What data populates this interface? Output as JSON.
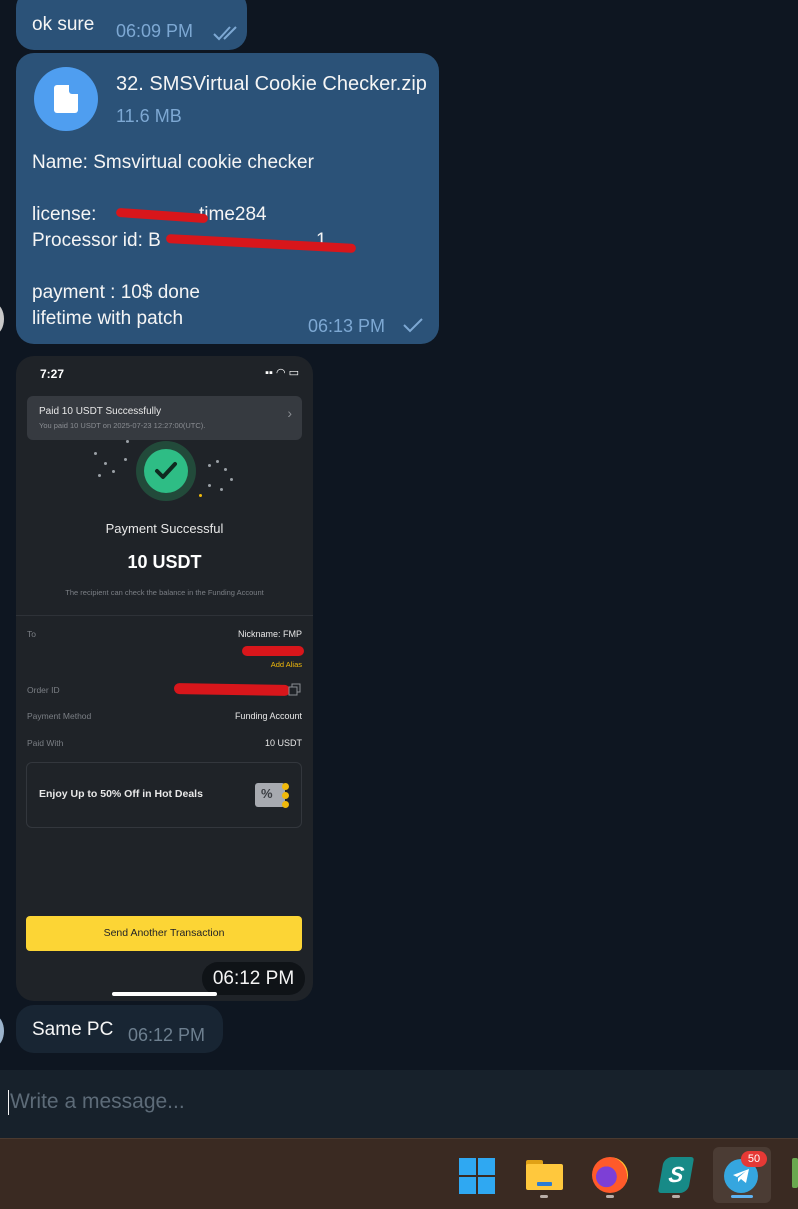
{
  "messages": {
    "ok_sure": {
      "text": "ok sure",
      "time": "06:09 PM"
    },
    "file_msg": {
      "file_name": "32. SMSVirtual Cookie Checker.zip",
      "file_size": "11.6 MB",
      "line_name": "Name: Smsvirtual cookie checker",
      "line_license": "license: ",
      "line_license_visible": "time284",
      "line_processor": "Processor id: B",
      "line_processor_tail": "1",
      "line_payment": "payment : 10$ done",
      "line_lifetime": "lifetime with patch",
      "time": "06:13 PM"
    },
    "screenshot_time": "06:12 PM",
    "same_pc": {
      "text": "Same PC",
      "time": "06:12 PM"
    }
  },
  "phone": {
    "status_time": "7:27",
    "status_icons": "▪▪ ◠ ▭",
    "banner_title": "Paid 10 USDT Successfully",
    "banner_sub": "You paid 10 USDT on 2025-07-23 12:27:00(UTC).",
    "banner_chevron": "›",
    "success_title": "Payment Successful",
    "amount": "10 USDT",
    "note": "The recipient can check the balance in the Funding Account",
    "to_label": "To",
    "to_value": "Nickname: FMP",
    "add_alias": "Add Alias",
    "order_label": "Order ID",
    "method_label": "Payment Method",
    "method_value": "Funding Account",
    "paid_label": "Paid With",
    "paid_value": "10 USDT",
    "promo": "Enjoy Up to 50% Off in Hot Deals",
    "coupon_symbol": "%",
    "button": "Send Another Transaction"
  },
  "compose": {
    "placeholder": "Write a message..."
  },
  "taskbar": {
    "items": [
      "windows-start",
      "file-explorer",
      "firefox",
      "surfshark",
      "telegram"
    ],
    "telegram_badge": "50"
  },
  "colors": {
    "outgoing_bubble": "#2b5278",
    "incoming_bubble": "#182533",
    "chat_bg": "#0e1621",
    "time_out": "#7da8d3",
    "pay_success": "#2ebd85",
    "pay_button": "#fcd535"
  }
}
